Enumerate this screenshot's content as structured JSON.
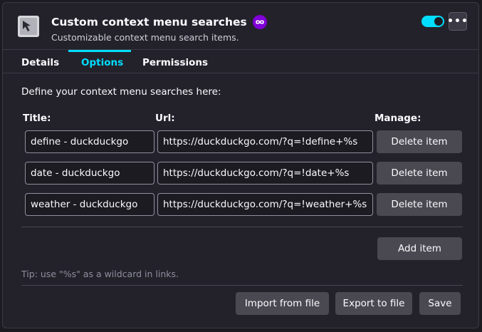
{
  "header": {
    "title": "Custom context menu searches",
    "subtitle": "Customizable context menu search items.",
    "badge_icon": "infinity-badge-icon",
    "enabled": true,
    "more_label": "•••"
  },
  "tabs": [
    {
      "label": "Details",
      "active": false
    },
    {
      "label": "Options",
      "active": true
    },
    {
      "label": "Permissions",
      "active": false
    }
  ],
  "options": {
    "intro": "Define your context menu searches here:",
    "headers": {
      "title": "Title:",
      "url": "Url:",
      "manage": "Manage:"
    },
    "rows": [
      {
        "title": "define - duckduckgo",
        "url": "https://duckduckgo.com/?q=!define+%s",
        "delete_label": "Delete item"
      },
      {
        "title": "date - duckduckgo",
        "url": "https://duckduckgo.com/?q=!date+%s",
        "delete_label": "Delete item"
      },
      {
        "title": "weather - duckduckgo",
        "url": "https://duckduckgo.com/?q=!weather+%s",
        "delete_label": "Delete item"
      }
    ],
    "add_label": "Add item",
    "tip": "Tip: use \"%s\" as a wildcard in links.",
    "import_label": "Import from file",
    "export_label": "Export to file",
    "save_label": "Save"
  },
  "colors": {
    "accent": "#00ddff",
    "badge": "#8000d7",
    "background": "#23222b"
  }
}
